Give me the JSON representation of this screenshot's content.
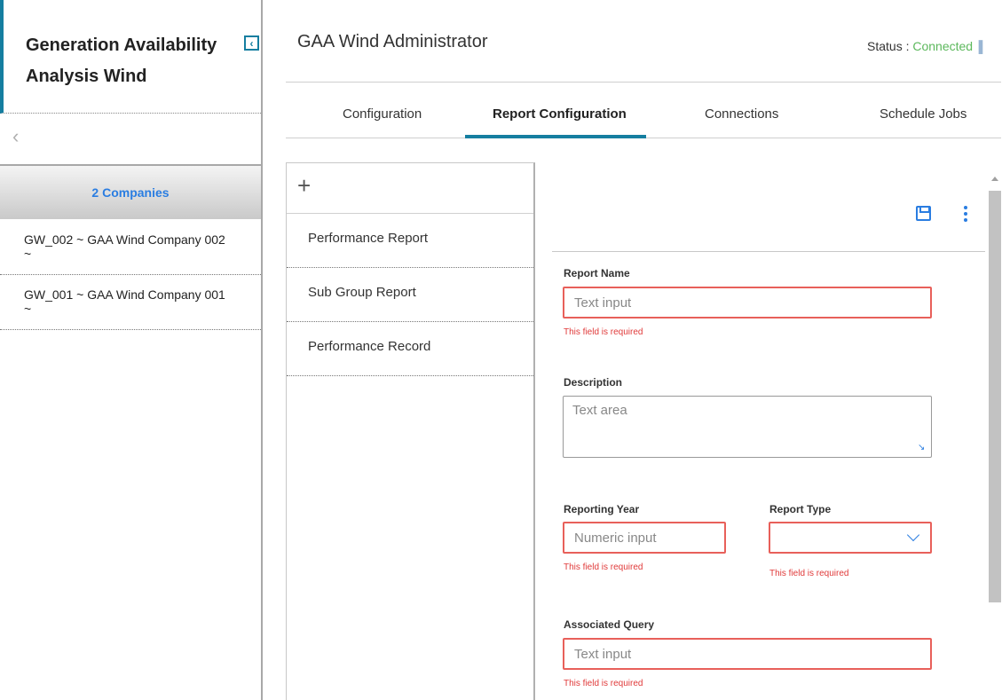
{
  "sidebar": {
    "title": "Generation Availability Analysis Wind",
    "collapse_icon": "chevron-left-icon",
    "back_icon": "chevron-left-icon",
    "companies_label": "2 Companies",
    "companies": [
      {
        "label": "GW_002 ~ GAA Wind Company 002 ~"
      },
      {
        "label": "GW_001 ~ GAA Wind Company 001 ~"
      }
    ]
  },
  "header": {
    "title": "GAA Wind Administrator",
    "status_prefix": "Status : ",
    "status_value": "Connected",
    "status_color": "#5cb85c",
    "status_icon": "signal-icon"
  },
  "tabs": [
    {
      "label": "Configuration",
      "active": false
    },
    {
      "label": "Report Configuration",
      "active": true
    },
    {
      "label": "Connections",
      "active": false
    },
    {
      "label": "Schedule Jobs",
      "active": false
    }
  ],
  "reports": {
    "add_icon": "plus-icon",
    "items": [
      {
        "label": "Performance Report"
      },
      {
        "label": "Sub Group Report"
      },
      {
        "label": "Performance Record"
      }
    ]
  },
  "form": {
    "toolbar": {
      "save_icon": "save-icon",
      "more_icon": "more-vertical-icon"
    },
    "report_name": {
      "label": "Report Name",
      "placeholder": "Text input",
      "error": "This field is required"
    },
    "description": {
      "label": "Description",
      "placeholder": "Text area"
    },
    "reporting_year": {
      "label": "Reporting Year",
      "placeholder": "Numeric input",
      "error": "This field is required"
    },
    "report_type": {
      "label": "Report Type",
      "value": "",
      "error": "This field is required"
    },
    "associated_query": {
      "label": "Associated Query",
      "placeholder": "Text input",
      "error": "This field is required"
    }
  },
  "colors": {
    "accent": "#157ea0",
    "link": "#2a7de1",
    "error": "#e03a3a"
  }
}
